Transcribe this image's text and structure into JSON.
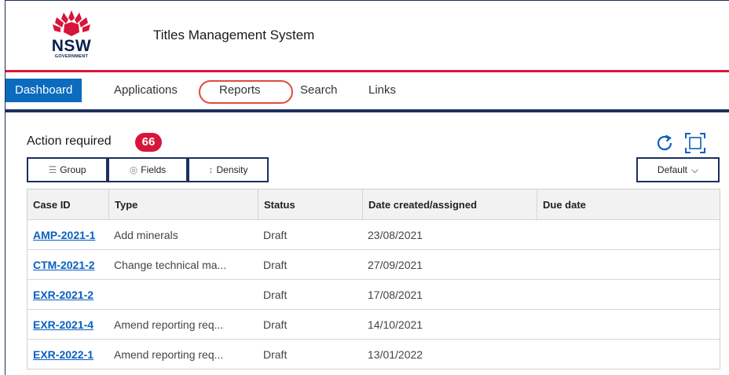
{
  "header": {
    "logo_wordmark": "NSW",
    "logo_subtext": "GOVERNMENT",
    "app_title": "Titles Management System"
  },
  "nav": {
    "items": [
      {
        "label": "Dashboard",
        "active": true
      },
      {
        "label": "Applications",
        "active": false
      },
      {
        "label": "Reports",
        "active": false
      },
      {
        "label": "Search",
        "active": false
      },
      {
        "label": "Links",
        "active": false
      }
    ]
  },
  "action": {
    "title": "Action required",
    "count": "66"
  },
  "toolbar": {
    "group_label": "Group",
    "fields_label": "Fields",
    "density_label": "Density",
    "view_label": "Default"
  },
  "table": {
    "columns": [
      "Case ID",
      "Type",
      "Status",
      "Date created/assigned",
      "Due date"
    ],
    "rows": [
      {
        "case_id": "AMP-2021-1",
        "type": "Add minerals",
        "status": "Draft",
        "date": "23/08/2021",
        "due": ""
      },
      {
        "case_id": "CTM-2021-2",
        "type": "Change technical ma...",
        "status": "Draft",
        "date": "27/09/2021",
        "due": ""
      },
      {
        "case_id": "EXR-2021-2",
        "type": "",
        "status": "Draft",
        "date": "17/08/2021",
        "due": ""
      },
      {
        "case_id": "EXR-2021-4",
        "type": "Amend reporting req...",
        "status": "Draft",
        "date": "14/10/2021",
        "due": ""
      },
      {
        "case_id": "EXR-2022-1",
        "type": "Amend reporting req...",
        "status": "Draft",
        "date": "13/01/2022",
        "due": ""
      }
    ]
  },
  "colors": {
    "nsw_red": "#d7153a",
    "nsw_navy": "#1d2f5e",
    "active_tab": "#0b6bbf",
    "link": "#0b5fbe",
    "highlight": "#e04b3a"
  }
}
